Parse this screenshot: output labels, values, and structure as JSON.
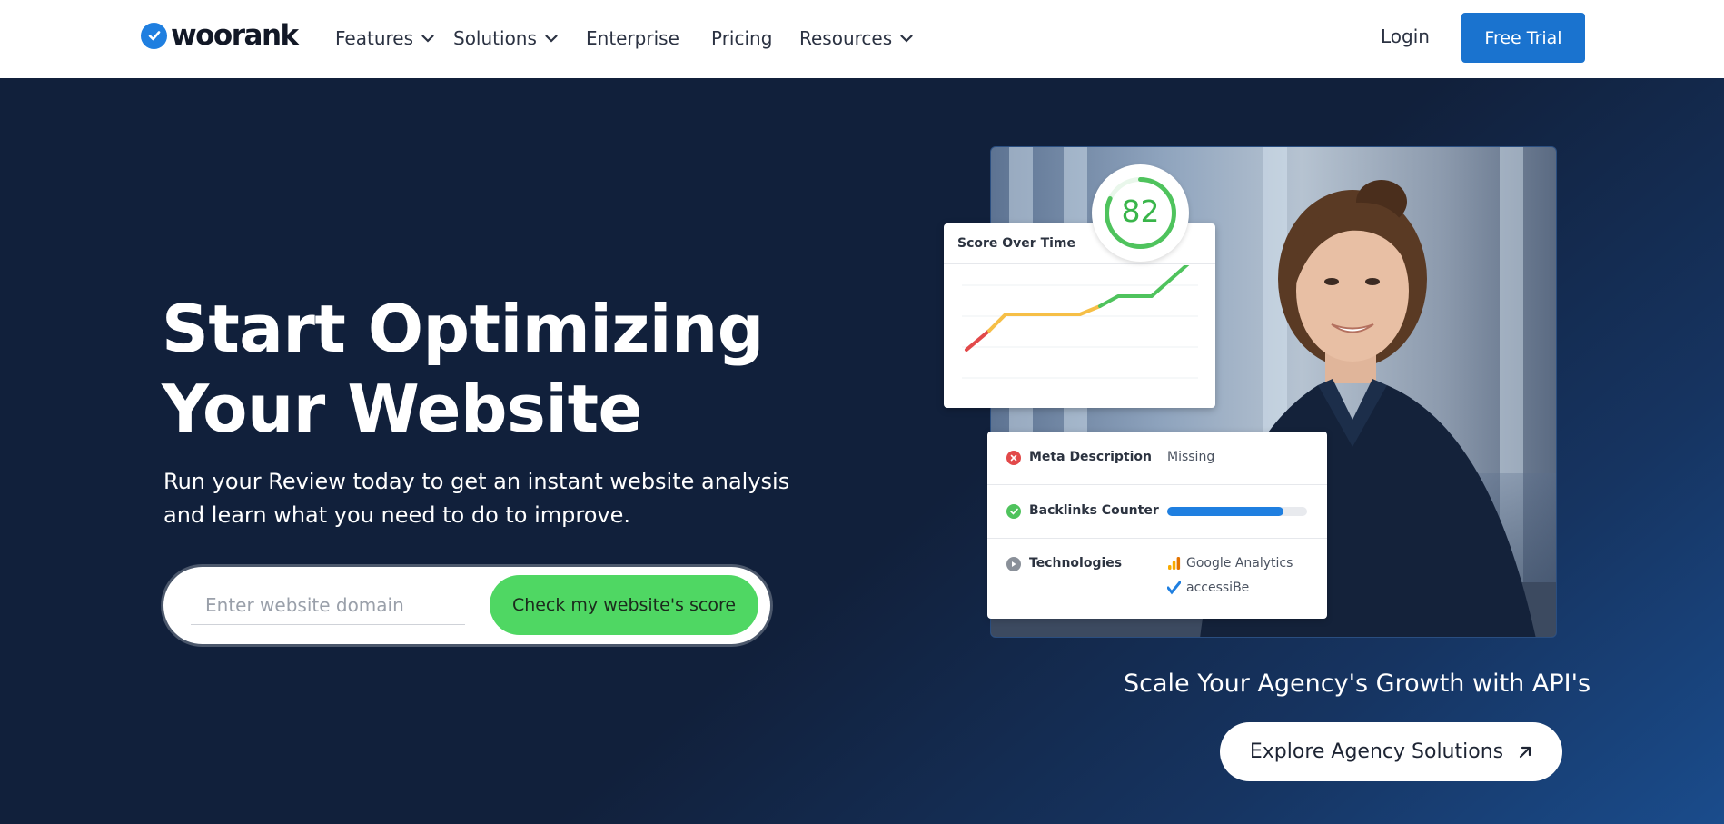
{
  "nav": {
    "logo_text": "woorank",
    "items": [
      {
        "label": "Features",
        "has_dropdown": true
      },
      {
        "label": "Solutions",
        "has_dropdown": true
      },
      {
        "label": "Enterprise",
        "has_dropdown": false
      },
      {
        "label": "Pricing",
        "has_dropdown": false
      },
      {
        "label": "Resources",
        "has_dropdown": true
      }
    ],
    "login_label": "Login",
    "trial_label": "Free Trial"
  },
  "hero": {
    "title_line1": "Start Optimizing",
    "title_line2": "Your Website",
    "subtitle_line1": "Run your Review today to get an instant website analysis",
    "subtitle_line2": "and learn what you need to do to improve.",
    "input_placeholder": "Enter website domain",
    "input_value": "",
    "cta_label": "Check my website's score"
  },
  "score_card": {
    "title": "Score Over Time",
    "score": "82"
  },
  "report": {
    "rows": [
      {
        "label": "Meta Description",
        "status": "error",
        "value": "Missing"
      },
      {
        "label": "Backlinks Counter",
        "status": "ok",
        "progress": 0.83
      },
      {
        "label": "Technologies",
        "status": "info",
        "techs": [
          "Google Analytics",
          "accessiBe"
        ]
      }
    ]
  },
  "agency": {
    "text": "Scale Your Agency's Growth with API's",
    "button_label": "Explore Agency Solutions"
  },
  "colors": {
    "brand_blue": "#1a73cf",
    "cta_green": "#4fd763",
    "hero_bg": "#11203a",
    "score_green": "#39b54a",
    "error_red": "#e2494a"
  },
  "icons": {
    "logo": "check-circle-icon",
    "dropdown": "chevron-down-icon",
    "agency_button": "arrow-up-right-icon"
  }
}
